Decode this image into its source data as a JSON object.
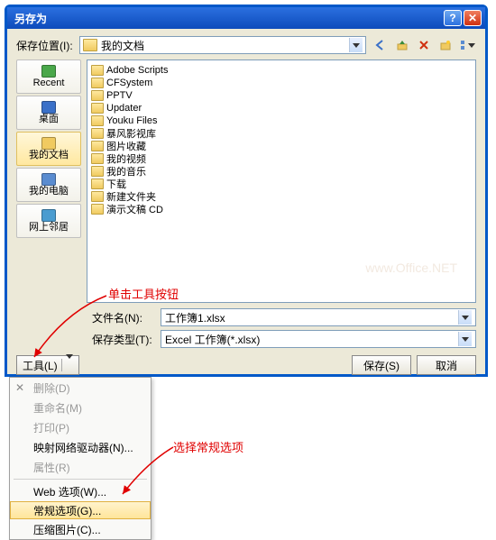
{
  "titlebar": {
    "title": "另存为"
  },
  "save_location_label": "保存位置(I):",
  "current_folder": "我的文档",
  "toolbar_icons": [
    "back-icon",
    "up-icon",
    "delete-icon",
    "new-folder-icon",
    "views-icon"
  ],
  "places": [
    {
      "id": "recent",
      "label": "Recent",
      "color": "#4aa84a"
    },
    {
      "id": "desktop",
      "label": "桌面",
      "color": "#3a70c8"
    },
    {
      "id": "mydocs",
      "label": "我的文档",
      "color": "#f0ca60",
      "selected": true
    },
    {
      "id": "mycomputer",
      "label": "我的电脑",
      "color": "#5a8cd0"
    },
    {
      "id": "network",
      "label": "网上邻居",
      "color": "#4a9cd0"
    }
  ],
  "files": [
    "Adobe Scripts",
    "CFSystem",
    "PPTV",
    "Updater",
    "Youku Files",
    "暴风影视库",
    "图片收藏",
    "我的视频",
    "我的音乐",
    "下载",
    "新建文件夹",
    "演示文稿 CD"
  ],
  "filename_label": "文件名(N):",
  "filename_value": "工作簿1.xlsx",
  "savetype_label": "保存类型(T):",
  "savetype_value": "Excel 工作簿(*.xlsx)",
  "tools_button": "工具(L)",
  "save_button": "保存(S)",
  "cancel_button": "取消",
  "tools_menu": [
    {
      "id": "delete",
      "label": "删除(D)",
      "disabled": true,
      "icon": "✕"
    },
    {
      "id": "rename",
      "label": "重命名(M)",
      "disabled": true
    },
    {
      "id": "print",
      "label": "打印(P)",
      "disabled": true
    },
    {
      "id": "map",
      "label": "映射网络驱动器(N)..."
    },
    {
      "id": "props",
      "label": "属性(R)",
      "disabled": true
    },
    {
      "sep": true
    },
    {
      "id": "webopts",
      "label": "Web 选项(W)..."
    },
    {
      "id": "general",
      "label": "常规选项(G)...",
      "hover": true
    },
    {
      "id": "compress",
      "label": "压缩图片(C)..."
    }
  ],
  "annotation_tools": "单击工具按钮",
  "annotation_general": "选择常规选项"
}
